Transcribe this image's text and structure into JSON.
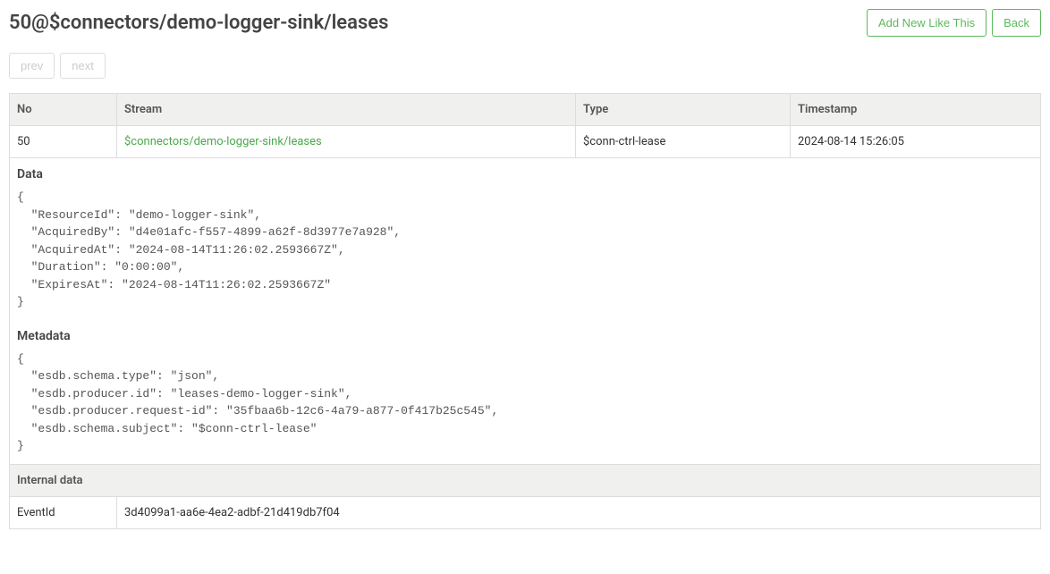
{
  "header": {
    "title": "50@$connectors/demo-logger-sink/leases",
    "add_button": "Add New Like This",
    "back_button": "Back"
  },
  "nav": {
    "prev": "prev",
    "next": "next"
  },
  "columns": {
    "no": "No",
    "stream": "Stream",
    "type": "Type",
    "timestamp": "Timestamp"
  },
  "row": {
    "no": "50",
    "stream": "$connectors/demo-logger-sink/leases",
    "type": "$conn-ctrl-lease",
    "timestamp": "2024-08-14 15:26:05"
  },
  "labels": {
    "data": "Data",
    "metadata": "Metadata",
    "internal_data": "Internal data",
    "event_id": "EventId"
  },
  "data_json": "{\n  \"ResourceId\": \"demo-logger-sink\",\n  \"AcquiredBy\": \"d4e01afc-f557-4899-a62f-8d3977e7a928\",\n  \"AcquiredAt\": \"2024-08-14T11:26:02.2593667Z\",\n  \"Duration\": \"0:00:00\",\n  \"ExpiresAt\": \"2024-08-14T11:26:02.2593667Z\"\n}",
  "metadata_json": "{\n  \"esdb.schema.type\": \"json\",\n  \"esdb.producer.id\": \"leases-demo-logger-sink\",\n  \"esdb.producer.request-id\": \"35fbaa6b-12c6-4a79-a877-0f417b25c545\",\n  \"esdb.schema.subject\": \"$conn-ctrl-lease\"\n}",
  "internal": {
    "event_id": "3d4099a1-aa6e-4ea2-adbf-21d419db7f04"
  }
}
